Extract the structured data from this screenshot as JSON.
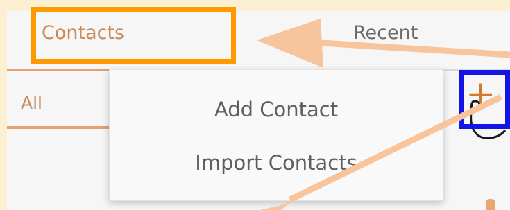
{
  "tabs": {
    "contacts": "Contacts",
    "recent": "Recent"
  },
  "subtabs": {
    "all": "All"
  },
  "dropdown": {
    "items": [
      "Add Contact",
      "Import Contacts"
    ]
  },
  "toolbar": {
    "add_button_icon": "plus-icon"
  },
  "colors": {
    "highlight_primary": "#ff9900",
    "highlight_secondary": "#1414e6",
    "annotation_arrow": "#f7c49b",
    "accent": "#e8a070"
  }
}
